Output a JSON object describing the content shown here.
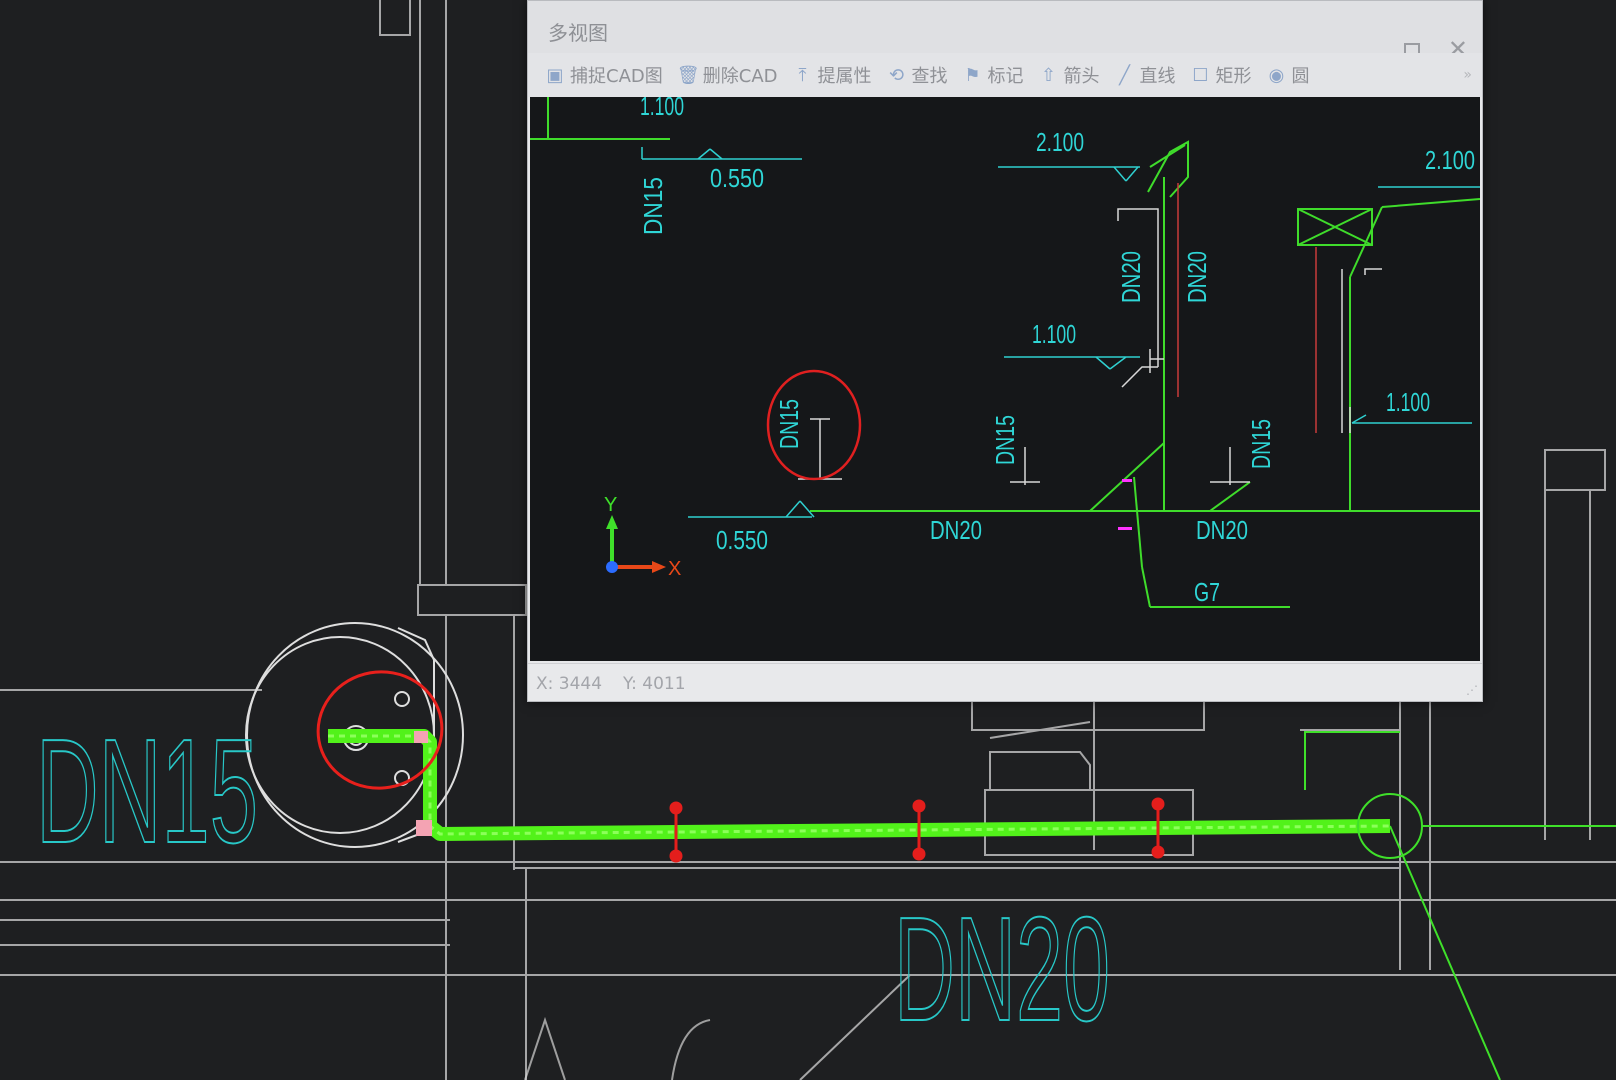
{
  "window": {
    "title": "多视图",
    "toolbar": [
      {
        "icon": "cad-capture-icon",
        "glyph": "▣",
        "label": "捕捉CAD图"
      },
      {
        "icon": "trash-icon",
        "glyph": "🗑",
        "label": "删除CAD"
      },
      {
        "icon": "extract-property-icon",
        "glyph": "⤒",
        "label": "提属性"
      },
      {
        "icon": "find-icon",
        "glyph": "⟲",
        "label": "查找"
      },
      {
        "icon": "mark-icon",
        "glyph": "⚑",
        "label": "标记"
      },
      {
        "icon": "arrow-icon",
        "glyph": "⇧",
        "label": "箭头"
      },
      {
        "icon": "line-icon",
        "glyph": "╱",
        "label": "直线"
      },
      {
        "icon": "rectangle-icon",
        "glyph": "☐",
        "label": "矩形"
      },
      {
        "icon": "circle-icon",
        "glyph": "◉",
        "label": "圆"
      }
    ],
    "more": "»",
    "status": {
      "x": "X: 3444",
      "y": "Y: 4011"
    }
  },
  "background_drawing": {
    "labels": {
      "dn15": "DN15",
      "dn20": "DN20"
    }
  },
  "multiview_drawing": {
    "elevations": [
      "1.100",
      "0.550",
      "2.100",
      "1.100",
      "2.100",
      "1.100",
      "0.550"
    ],
    "pipe_labels": [
      "DN15",
      "DN20",
      "DN20",
      "DN15",
      "DN15",
      "DN20",
      "DN20"
    ],
    "riser": "G7",
    "axis": {
      "x": "X",
      "y": "Y"
    }
  },
  "colors": {
    "cad_bg": "#1e1f21",
    "wall_line": "#d6d6d6",
    "cyan_text": "#2fd6d6",
    "pipe_green": "#39e61d",
    "highlight_green": "#5cff1f",
    "marker_red": "#e8201c"
  }
}
